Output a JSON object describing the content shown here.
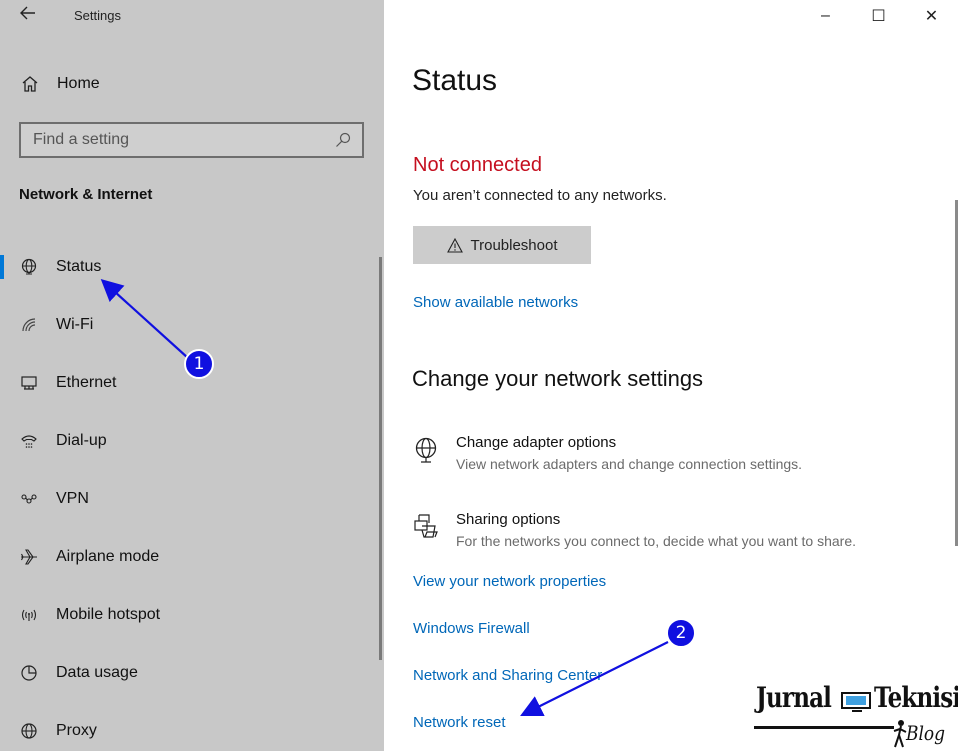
{
  "app": {
    "title": "Settings",
    "back_icon": "back-arrow-icon"
  },
  "window": {
    "minimize": "–",
    "maximize": "☐",
    "close": "✕"
  },
  "sidebar": {
    "home_label": "Home",
    "search_placeholder": "Find a setting",
    "section": "Network & Internet",
    "items": [
      {
        "label": "Status",
        "icon": "globe-icon",
        "active": true
      },
      {
        "label": "Wi-Fi",
        "icon": "wifi-icon"
      },
      {
        "label": "Ethernet",
        "icon": "ethernet-icon"
      },
      {
        "label": "Dial-up",
        "icon": "dialup-icon"
      },
      {
        "label": "VPN",
        "icon": "vpn-icon"
      },
      {
        "label": "Airplane mode",
        "icon": "airplane-icon"
      },
      {
        "label": "Mobile hotspot",
        "icon": "hotspot-icon"
      },
      {
        "label": "Data usage",
        "icon": "data-usage-icon"
      },
      {
        "label": "Proxy",
        "icon": "proxy-globe-icon"
      }
    ]
  },
  "main": {
    "title": "Status",
    "status": "Not connected",
    "status_desc": "You aren’t connected to any networks.",
    "troubleshoot": "Troubleshoot",
    "show_networks": "Show available networks",
    "change_heading": "Change your network settings",
    "options": [
      {
        "title": "Change adapter options",
        "desc": "View network adapters and change connection settings.",
        "icon": "adapter-icon"
      },
      {
        "title": "Sharing options",
        "desc": "For the networks you connect to, decide what you want to share.",
        "icon": "sharing-icon"
      }
    ],
    "links": [
      "View your network properties",
      "Windows Firewall",
      "Network and Sharing Center",
      "Network reset"
    ]
  },
  "annotations": {
    "badge1": "1",
    "badge2": "2"
  },
  "watermark": {
    "word1": "Jurnal",
    "word2": "Teknisi",
    "blog": "Blog"
  },
  "colors": {
    "accent": "#0078d7",
    "link": "#0067b8",
    "error": "#c50f1f",
    "annotation": "#1010e0"
  }
}
